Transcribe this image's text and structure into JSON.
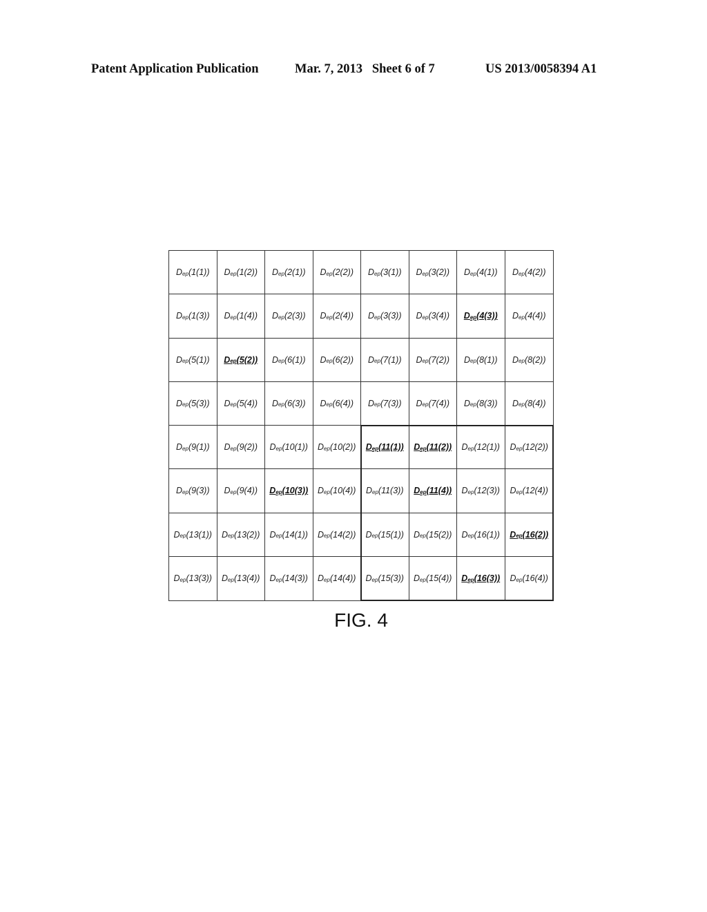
{
  "header": {
    "left": "Patent Application Publication",
    "middle": "Mar. 7, 2013   Sheet 6 of 7",
    "right": "US 2013/0058394 A1"
  },
  "figure": {
    "caption": "FIG. 4",
    "symbol": "D",
    "subscript": "ep",
    "rows": [
      [
        {
          "t": "(1(1))"
        },
        {
          "t": "(1(2))"
        },
        {
          "t": "(2(1))"
        },
        {
          "t": "(2(2))"
        },
        {
          "t": "(3(1))"
        },
        {
          "t": "(3(2))"
        },
        {
          "t": "(4(1))"
        },
        {
          "t": "(4(2))"
        }
      ],
      [
        {
          "t": "(1(3))"
        },
        {
          "t": "(1(4))"
        },
        {
          "t": "(2(3))"
        },
        {
          "t": "(2(4))"
        },
        {
          "t": "(3(3))"
        },
        {
          "t": "(3(4))"
        },
        {
          "t": "(4(3))",
          "hl": true
        },
        {
          "t": "(4(4))"
        }
      ],
      [
        {
          "t": "(5(1))"
        },
        {
          "t": "(5(2))",
          "hl": true
        },
        {
          "t": "(6(1))"
        },
        {
          "t": "(6(2))"
        },
        {
          "t": "(7(1))"
        },
        {
          "t": "(7(2))"
        },
        {
          "t": "(8(1))"
        },
        {
          "t": "(8(2))"
        }
      ],
      [
        {
          "t": "(5(3))"
        },
        {
          "t": "(5(4))"
        },
        {
          "t": "(6(3))"
        },
        {
          "t": "(6(4))"
        },
        {
          "t": "(7(3))"
        },
        {
          "t": "(7(4))"
        },
        {
          "t": "(8(3))"
        },
        {
          "t": "(8(4))"
        }
      ],
      [
        {
          "t": "(9(1))"
        },
        {
          "t": "(9(2))"
        },
        {
          "t": "(10(1))"
        },
        {
          "t": "(10(2))"
        },
        {
          "t": "(11(1))",
          "hl": true
        },
        {
          "t": "(11(2))",
          "hl": true
        },
        {
          "t": "(12(1))"
        },
        {
          "t": "(12(2))"
        }
      ],
      [
        {
          "t": "(9(3))"
        },
        {
          "t": "(9(4))"
        },
        {
          "t": "(10(3))",
          "hl": true
        },
        {
          "t": "(10(4))"
        },
        {
          "t": "(11(3))"
        },
        {
          "t": "(11(4))",
          "hl": true
        },
        {
          "t": "(12(3))"
        },
        {
          "t": "(12(4))"
        }
      ],
      [
        {
          "t": "(13(1))"
        },
        {
          "t": "(13(2))"
        },
        {
          "t": "(14(1))"
        },
        {
          "t": "(14(2))"
        },
        {
          "t": "(15(1))"
        },
        {
          "t": "(15(2))"
        },
        {
          "t": "(16(1))"
        },
        {
          "t": "(16(2))",
          "hl": true
        }
      ],
      [
        {
          "t": "(13(3))"
        },
        {
          "t": "(13(4))"
        },
        {
          "t": "(14(3))"
        },
        {
          "t": "(14(4))"
        },
        {
          "t": "(15(3))"
        },
        {
          "t": "(15(4))"
        },
        {
          "t": "(16(3))",
          "hl": true
        },
        {
          "t": "(16(4))"
        }
      ]
    ]
  }
}
